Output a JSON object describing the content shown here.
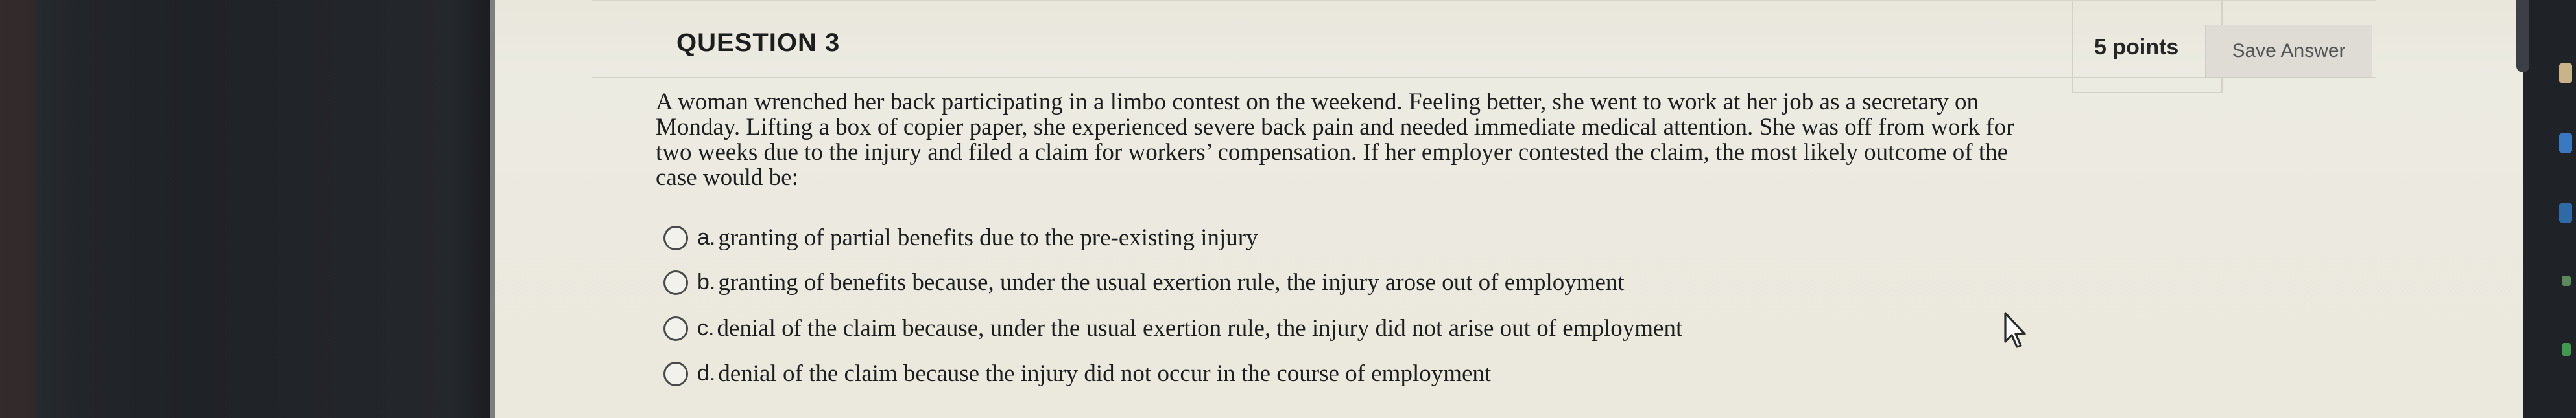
{
  "question": {
    "title": "QUESTION 3",
    "points": "5 points",
    "save_label": "Save Answer",
    "text": "A woman wrenched her back participating in a limbo contest on the weekend. Feeling better, she went to work at her job as a secretary on Monday. Lifting a box of copier paper, she experienced severe back pain and needed immediate medical attention. She was off from work for two weeks due to the injury and filed a claim for workers’ compensation. If her employer contested the claim, the most likely outcome of the case would be:",
    "options": [
      {
        "letter": "a.",
        "text": "granting of partial benefits due to the pre-existing injury"
      },
      {
        "letter": "b.",
        "text": "granting of benefits because, under the usual exertion rule, the injury arose out of employment"
      },
      {
        "letter": "c.",
        "text": "denial of the claim because, under the usual exertion rule, the injury did not arise out of employment"
      },
      {
        "letter": "d.",
        "text": "denial of the claim because the injury did not occur in the course of employment"
      }
    ]
  },
  "icons": {
    "cursor": "mouse-pointer-icon"
  },
  "colors": {
    "background": "#ebe8dd",
    "save_button": "#dedcd5",
    "text": "#1e1e1e"
  }
}
